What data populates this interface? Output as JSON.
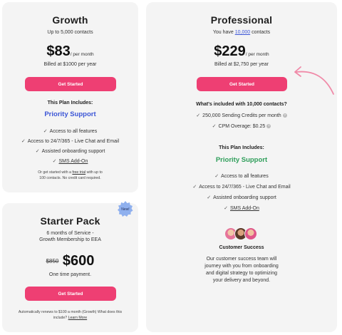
{
  "growth": {
    "name": "Growth",
    "contacts": "Up to 5,000 contacts",
    "price": "$83",
    "per": "/ per month",
    "billed": "Billed at $1000 per year",
    "cta": "Get Started",
    "includes_title": "This Plan Includes:",
    "priority": "Priority Support",
    "priority_color": "#3b55d6",
    "features": [
      "Access to all features",
      "Access to 24/7/365 - Live Chat and Email",
      "Assisted onboarding support",
      "SMS Add-On"
    ],
    "note_pre": "Or get started with a",
    "note_link": "free trial",
    "note_post": "with up to",
    "note_line2": "100 contacts. No credit card required."
  },
  "starter": {
    "badge": "New!",
    "name": "Starter Pack",
    "desc_line1": "6 months of Service -",
    "desc_line2": "Growth Membership to EEA",
    "old_price": "$850",
    "price": "$600",
    "payment": "One time payment.",
    "cta": "Get Started",
    "renew_line1": "Automatically renews to $100 a month (Growth) What does this",
    "renew_line2_pre": "include?",
    "renew_link": "Learn More"
  },
  "professional": {
    "name": "Professional",
    "contacts_pre": "You have",
    "contacts_link": "10,000",
    "contacts_post": "contacts",
    "price": "$229",
    "per": "/ per month",
    "billed": "Billed at $2,750 per year",
    "cta": "Get Started",
    "included_title": "What's included with 10,000 contacts?",
    "credits": [
      "250,000 Sending Credits per month",
      "CPM Overage: $0.25"
    ],
    "includes_title": "This Plan Includes:",
    "priority": "Priority Support",
    "priority_color": "#2e9e5a",
    "features": [
      "Access to all features",
      "Access to 24/7/365 - Live Chat and Email",
      "Assisted onboarding support",
      "SMS Add-On"
    ],
    "success_title": "Customer Success",
    "success_lines": [
      "Our customer success team will",
      "journey with you from onboarding",
      "and digital strategy to optimizing",
      "your delivery and beyond."
    ]
  },
  "colors": {
    "cta": "#ee3f73",
    "card": "#f4f4f4",
    "badge": "#8fb0ee",
    "arrow": "#f08aa8"
  },
  "icons": [
    "check-icon",
    "question-icon",
    "arrow-icon",
    "badge-icon"
  ]
}
